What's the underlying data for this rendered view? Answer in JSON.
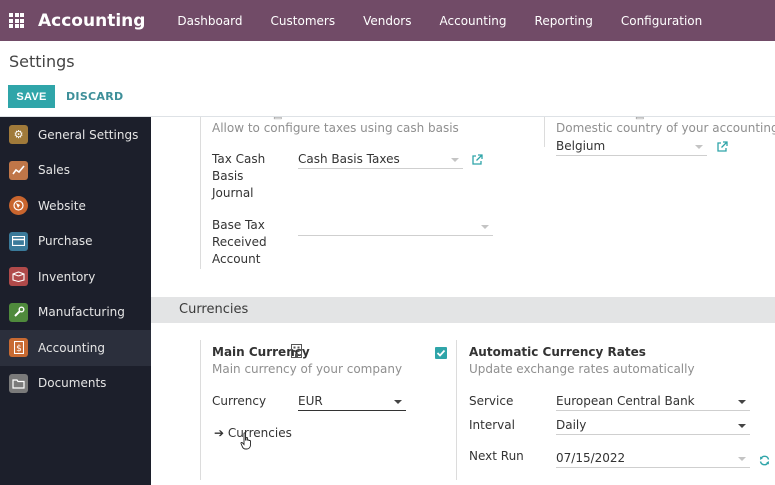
{
  "topbar": {
    "app_title": "Accounting",
    "nav": [
      "Dashboard",
      "Customers",
      "Vendors",
      "Accounting",
      "Reporting",
      "Configuration"
    ]
  },
  "control_panel": {
    "title": "Settings",
    "save_label": "SAVE",
    "discard_label": "DISCARD"
  },
  "sidebar": {
    "items": [
      {
        "label": "General Settings",
        "icon": "gear-icon",
        "color": "#a07a3a"
      },
      {
        "label": "Sales",
        "icon": "chart-icon",
        "color": "#c07648"
      },
      {
        "label": "Website",
        "icon": "globe-icon",
        "color": "#c9652e"
      },
      {
        "label": "Purchase",
        "icon": "card-icon",
        "color": "#3a7a9a"
      },
      {
        "label": "Inventory",
        "icon": "box-icon",
        "color": "#b04a4a"
      },
      {
        "label": "Manufacturing",
        "icon": "wrench-icon",
        "color": "#4f8a3c"
      },
      {
        "label": "Accounting",
        "icon": "doc-dollar-icon",
        "color": "#c86a32"
      },
      {
        "label": "Documents",
        "icon": "folder-icon",
        "color": "#7a7a7a"
      }
    ],
    "active_index": 6
  },
  "main": {
    "cash_basis_desc": "Allow to configure taxes using cash basis",
    "country_desc": "Domestic country of your accounting",
    "country_value": "Belgium",
    "tax_cash_label_lines": [
      "Tax Cash",
      "Basis",
      "Journal"
    ],
    "tax_cash_value": "Cash Basis Taxes",
    "base_tax_label_lines": [
      "Base Tax",
      "Received",
      "Account"
    ],
    "base_tax_value": "",
    "currencies_section": "Currencies",
    "main_currency_title": "Main Currency",
    "main_currency_desc": "Main currency of your company",
    "currency_label": "Currency",
    "currency_value": "EUR",
    "currencies_link": "Currencies",
    "auto_rates_title": "Automatic Currency Rates",
    "auto_rates_desc": "Update exchange rates automatically",
    "auto_rates_checked": true,
    "service_label": "Service",
    "service_value": "European Central Bank",
    "interval_label": "Interval",
    "interval_value": "Daily",
    "next_run_label": "Next Run",
    "next_run_value": "07/15/2022"
  }
}
